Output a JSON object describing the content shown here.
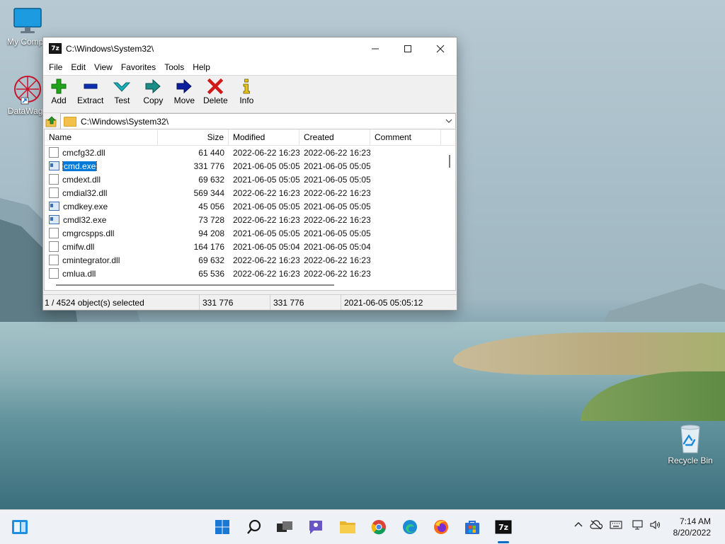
{
  "desktop": {
    "icons": [
      {
        "label": "My Compu"
      },
      {
        "label": "DataWago"
      },
      {
        "label": "Recycle Bin"
      }
    ]
  },
  "window": {
    "title": "C:\\Windows\\System32\\",
    "app_badge": "7z",
    "menu": [
      "File",
      "Edit",
      "View",
      "Favorites",
      "Tools",
      "Help"
    ],
    "toolbar": {
      "add": "Add",
      "extract": "Extract",
      "test": "Test",
      "copy": "Copy",
      "move": "Move",
      "delete": "Delete",
      "info": "Info"
    },
    "address": "C:\\Windows\\System32\\",
    "columns": {
      "name": "Name",
      "size": "Size",
      "modified": "Modified",
      "created": "Created",
      "comment": "Comment"
    },
    "files": [
      {
        "name": "cmcfg32.dll",
        "size": "61 440",
        "modified": "2022-06-22 16:23",
        "created": "2022-06-22 16:23",
        "comment": ""
      },
      {
        "name": "cmd.exe",
        "size": "331 776",
        "modified": "2021-06-05 05:05",
        "created": "2021-06-05 05:05",
        "comment": ""
      },
      {
        "name": "cmdext.dll",
        "size": "69 632",
        "modified": "2021-06-05 05:05",
        "created": "2021-06-05 05:05",
        "comment": ""
      },
      {
        "name": "cmdial32.dll",
        "size": "569 344",
        "modified": "2022-06-22 16:23",
        "created": "2022-06-22 16:23",
        "comment": ""
      },
      {
        "name": "cmdkey.exe",
        "size": "45 056",
        "modified": "2021-06-05 05:05",
        "created": "2021-06-05 05:05",
        "comment": ""
      },
      {
        "name": "cmdl32.exe",
        "size": "73 728",
        "modified": "2022-06-22 16:23",
        "created": "2022-06-22 16:23",
        "comment": ""
      },
      {
        "name": "cmgrcspps.dll",
        "size": "94 208",
        "modified": "2021-06-05 05:05",
        "created": "2021-06-05 05:05",
        "comment": ""
      },
      {
        "name": "cmifw.dll",
        "size": "164 176",
        "modified": "2021-06-05 05:04",
        "created": "2021-06-05 05:04",
        "comment": ""
      },
      {
        "name": "cmintegrator.dll",
        "size": "69 632",
        "modified": "2022-06-22 16:23",
        "created": "2022-06-22 16:23",
        "comment": ""
      },
      {
        "name": "cmlua.dll",
        "size": "65 536",
        "modified": "2022-06-22 16:23",
        "created": "2022-06-22 16:23",
        "comment": ""
      }
    ],
    "selected_index": 1,
    "status": {
      "selection": "1 / 4524 object(s) selected",
      "size": "331 776",
      "packed": "331 776",
      "date": "2021-06-05 05:05:12"
    }
  },
  "taskbar": {
    "time": "7:14 AM",
    "date": "8/20/2022",
    "apps": [
      "start-icon",
      "search-icon",
      "task-view-icon",
      "chat-icon",
      "file-explorer-icon",
      "chrome-icon",
      "edge-icon",
      "firefox-icon",
      "store-icon",
      "7zip-icon"
    ]
  },
  "colors": {
    "selection": "#0078d7",
    "taskbar_bg": "#eef1f5",
    "add_green": "#21a31b",
    "extract_blue": "#0b2fb0",
    "test_teal": "#19b1b9",
    "delete_red": "#d01818"
  }
}
